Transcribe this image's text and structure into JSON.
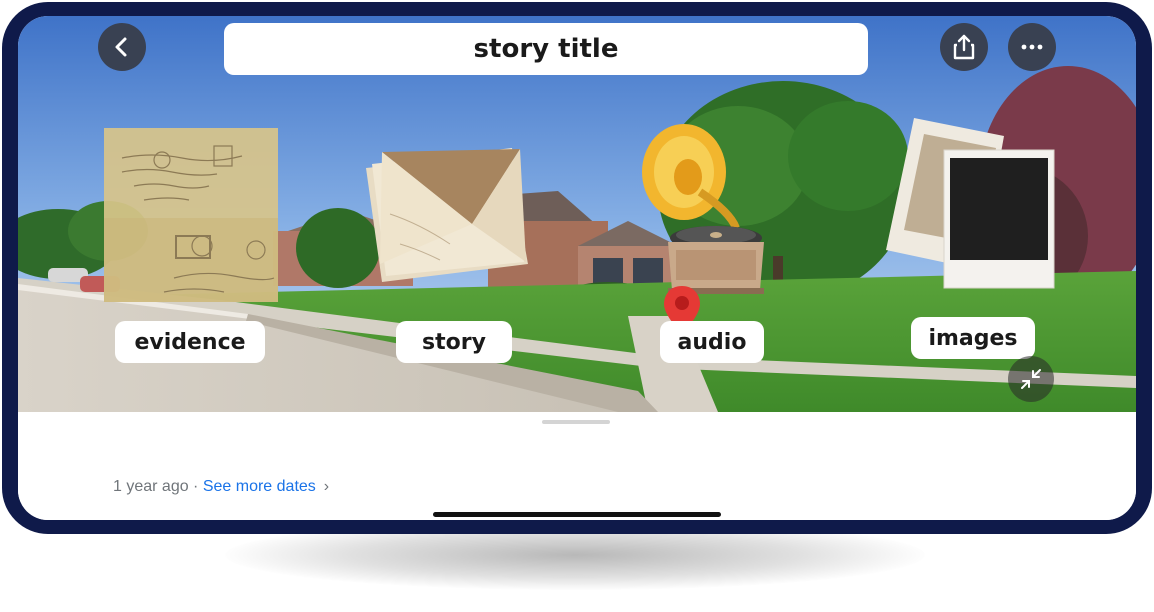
{
  "header": {
    "title": "story title",
    "back_icon": "chevron-left-icon",
    "share_icon": "share-icon",
    "more_icon": "more-horizontal-icon"
  },
  "hotspots": [
    {
      "label": "evidence",
      "icon": "old-letter-icon"
    },
    {
      "label": "story",
      "icon": "envelope-icon"
    },
    {
      "label": "audio",
      "icon": "gramophone-icon"
    },
    {
      "label": "images",
      "icon": "polaroid-photos-icon"
    }
  ],
  "map_pin": "location-pin-icon",
  "collapse_icon": "collapse-arrows-icon",
  "footer": {
    "age": "1 year ago",
    "separator": " · ",
    "see_more": "See more dates",
    "chevron": "›"
  },
  "colors": {
    "frame": "#0f1a4a",
    "link": "#1a73e8",
    "pin": "#e53935"
  }
}
